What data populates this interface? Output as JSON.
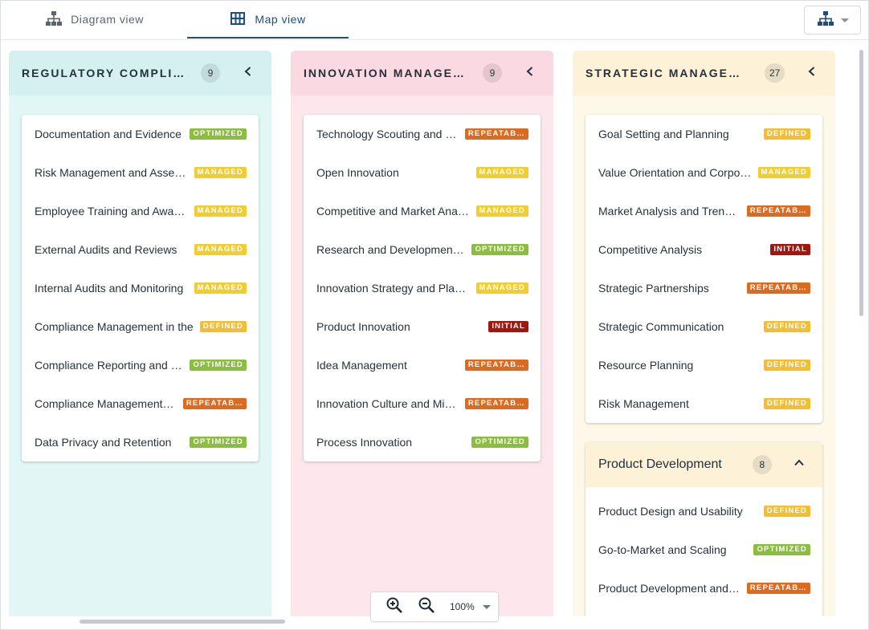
{
  "tabs": [
    {
      "label": "Diagram view",
      "icon": "hierarchy-icon",
      "active": false
    },
    {
      "label": "Map view",
      "icon": "grid-icon",
      "active": true
    }
  ],
  "view_switcher": {
    "icon": "org-chart-icon"
  },
  "badge_colors": {
    "OPTIMIZED": "#8bbd3f",
    "MANAGED": "#f2cd2e",
    "DEFINED": "#f6be2f",
    "REPEATAB…": "#dd6b1f",
    "INITIAL": "#a3160f"
  },
  "columns": [
    {
      "title": "REGULATORY COMPLIANCE",
      "count": "9",
      "bg": "#e2f6f5",
      "header_bg": "#d4f1f0",
      "items": [
        {
          "label": "Documentation and Evidence",
          "badge": "OPTIMIZED"
        },
        {
          "label": "Risk Management and Assessment",
          "badge": "MANAGED"
        },
        {
          "label": "Employee Training and Awareness",
          "badge": "MANAGED"
        },
        {
          "label": "External Audits and Reviews",
          "badge": "MANAGED"
        },
        {
          "label": "Internal Audits and Monitoring",
          "badge": "MANAGED"
        },
        {
          "label": "Compliance Management in the",
          "badge": "DEFINED"
        },
        {
          "label": "Compliance Reporting and Documentation",
          "badge": "OPTIMIZED"
        },
        {
          "label": "Compliance Management System",
          "badge": "REPEATAB…"
        },
        {
          "label": "Data Privacy and Retention",
          "badge": "OPTIMIZED"
        }
      ]
    },
    {
      "title": "INNOVATION MANAGEMENT",
      "count": "9",
      "bg": "#fde6ec",
      "header_bg": "#fbd9e2",
      "items": [
        {
          "label": "Technology Scouting and Monitoring",
          "badge": "REPEATAB…"
        },
        {
          "label": "Open Innovation",
          "badge": "MANAGED"
        },
        {
          "label": "Competitive and Market Analysis",
          "badge": "MANAGED"
        },
        {
          "label": "Research and Development Management",
          "badge": "OPTIMIZED"
        },
        {
          "label": "Innovation Strategy and Planning",
          "badge": "MANAGED"
        },
        {
          "label": "Product Innovation",
          "badge": "INITIAL"
        },
        {
          "label": "Idea Management",
          "badge": "REPEATAB…"
        },
        {
          "label": "Innovation Culture and Mindset",
          "badge": "REPEATAB…"
        },
        {
          "label": "Process Innovation",
          "badge": "OPTIMIZED"
        }
      ]
    },
    {
      "title": "STRATEGIC MANAGEMENT",
      "count": "27",
      "bg": "#fef8e8",
      "header_bg": "#fdf1d8",
      "items": [
        {
          "label": "Goal Setting and Planning",
          "badge": "DEFINED"
        },
        {
          "label": "Value Orientation and Corporate Culture",
          "badge": "MANAGED"
        },
        {
          "label": "Market Analysis and Trend Monitoring",
          "badge": "REPEATAB…"
        },
        {
          "label": "Competitive Analysis",
          "badge": "INITIAL"
        },
        {
          "label": "Strategic Partnerships",
          "badge": "REPEATAB…"
        },
        {
          "label": "Strategic Communication",
          "badge": "DEFINED"
        },
        {
          "label": "Resource Planning",
          "badge": "DEFINED"
        },
        {
          "label": "Risk Management",
          "badge": "DEFINED"
        }
      ],
      "subgroup": {
        "title": "Product Development",
        "count": "8",
        "items": [
          {
            "label": "Product Design and Usability",
            "badge": "DEFINED"
          },
          {
            "label": "Go-to-Market and Scaling",
            "badge": "OPTIMIZED"
          },
          {
            "label": "Product Development and Innovation",
            "badge": "REPEATAB…"
          }
        ]
      }
    }
  ],
  "zoom": {
    "value": "100%"
  }
}
